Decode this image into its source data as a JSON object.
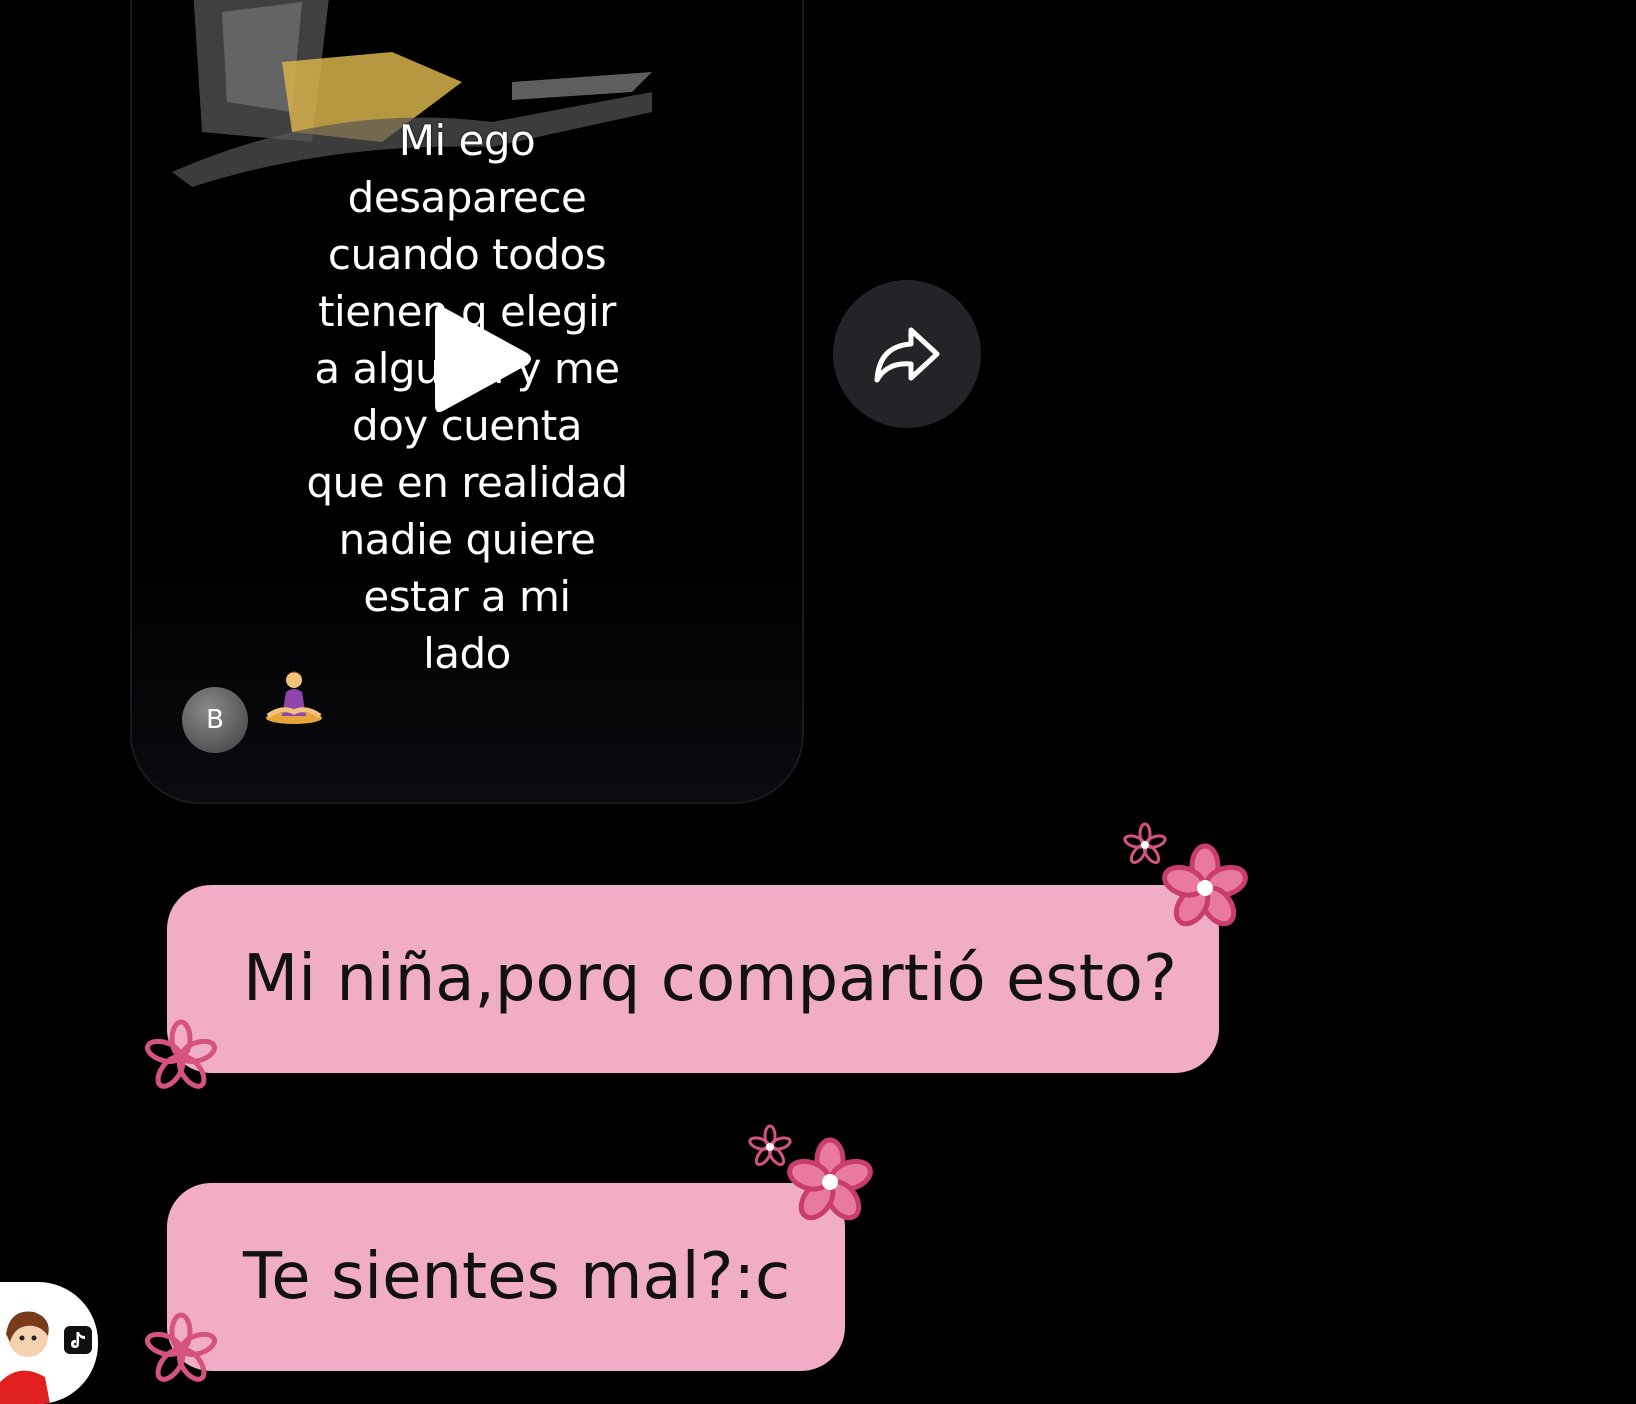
{
  "shared_video": {
    "caption": "Mi ego\ndesaparece\ncuando todos\ntienen q elegir\na alguien y me\ndoy cuenta\nque en realidad\nnadie quiere\nestar a mi\nlado",
    "author_initial": "B",
    "emoji": "person-in-lotus-position",
    "play_icon": "play-icon"
  },
  "share_button": {
    "icon": "share-arrow-icon"
  },
  "messages": [
    {
      "text": "Mi niña,porq compartió esto?"
    },
    {
      "text": "Te sientes mal?:c"
    }
  ],
  "colors": {
    "background": "#000000",
    "bubble": "#f1adc6",
    "bubble_text": "#111111",
    "flower": "#d5547f",
    "share_button_bg": "#242428"
  },
  "user_avatar": {
    "badge_icon": "tiktok-icon"
  }
}
